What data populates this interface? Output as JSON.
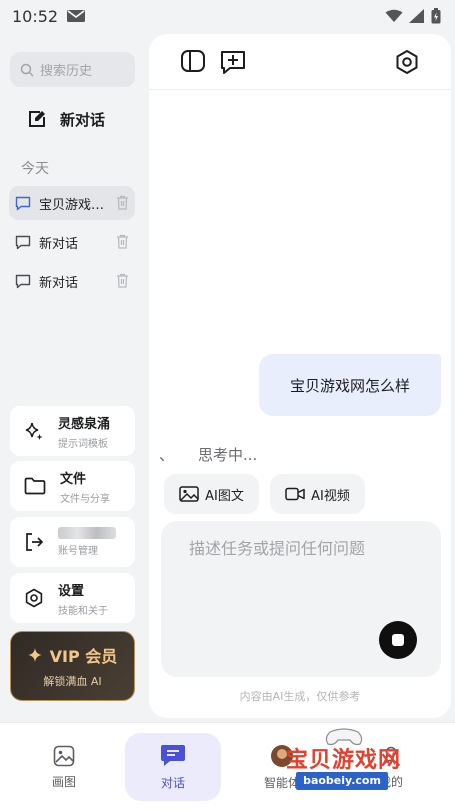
{
  "status_bar": {
    "time": "10:52"
  },
  "sidebar": {
    "search_placeholder": "搜索历史",
    "new_chat_label": "新对话",
    "section_today": "今天",
    "conversations": [
      {
        "label": "宝贝游戏网怎么样",
        "active": true
      },
      {
        "label": "新对话",
        "active": false
      },
      {
        "label": "新对话",
        "active": false
      }
    ],
    "tools": [
      {
        "title": "灵感泉涌",
        "subtitle": "提示词模板",
        "icon": "sparkle-icon"
      },
      {
        "title": "文件",
        "subtitle": "文件与分享",
        "icon": "folder-icon"
      },
      {
        "title": "",
        "subtitle": "账号管理",
        "icon": "logout-icon"
      },
      {
        "title": "设置",
        "subtitle": "技能和关于",
        "icon": "settings-icon"
      }
    ],
    "vip": {
      "title": "VIP 会员",
      "subtitle": "解锁满血 AI"
    }
  },
  "chat": {
    "user_message": "宝贝游戏网怎么样",
    "thinking_mark": "、",
    "thinking_text": "思考中...",
    "chips": [
      {
        "label": "AI图文",
        "icon": "image-icon"
      },
      {
        "label": "AI视频",
        "icon": "video-icon"
      }
    ],
    "input_placeholder": "描述任务或提问任何问题",
    "disclaimer": "内容由AI生成，仅供参考"
  },
  "bottom_nav": {
    "items": [
      {
        "label": "画图",
        "icon": "image-icon"
      },
      {
        "label": "对话",
        "icon": "chat-icon",
        "active": true
      },
      {
        "label": "智能体",
        "icon": "agent-icon"
      },
      {
        "label": "我的",
        "icon": "user-icon"
      }
    ]
  },
  "watermark": {
    "title": "宝贝游戏网",
    "url": "baobeiy.com"
  },
  "colors": {
    "accent": "#4c4fd8",
    "bubble": "#e8eefc",
    "vip_gold": "#f1c88a",
    "watermark_red": "#e3402e"
  }
}
